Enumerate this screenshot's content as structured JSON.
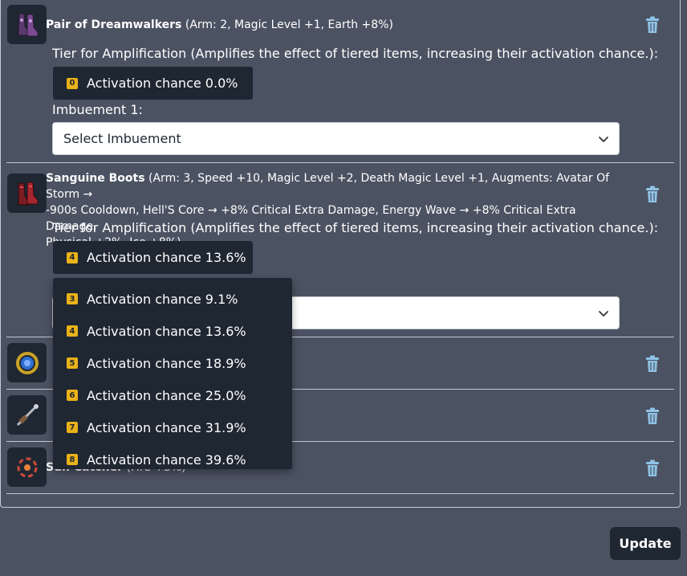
{
  "items": [
    {
      "name": "Pair of Dreamwalkers",
      "desc": "(Arm: 2, Magic Level +1, Earth +8%)",
      "icon": "dreamwalkers-boots-icon",
      "tier_label": "Tier for Amplification (Amplifies the effect of tiered items, increasing their activation chance.):",
      "tier_badge": "0",
      "tier_value": "Activation chance 0.0%",
      "imbuement_label": "Imbuement 1:",
      "imbuement_value": "Select Imbuement"
    },
    {
      "name": "Sanguine Boots",
      "desc_line1": "(Arm: 3, Speed +10, Magic Level +2, Death Magic Level +1, Augments: Avatar Of Storm →",
      "desc_line2": "-900s Cooldown, Hell'S Core → +8% Critical Extra Damage, Energy Wave → +8% Critical Extra Damage,",
      "desc_line3": "Physical +2%, Ice +8%)",
      "icon": "sanguine-boots-icon",
      "tier_label": "Tier for Amplification (Amplifies the effect of tiered items, increasing their activation chance.):",
      "tier_badge": "4",
      "tier_value": "Activation chance 13.6%"
    },
    {
      "icon": "ring-icon"
    },
    {
      "icon": "weapon-icon"
    },
    {
      "name": "Sun Catcher",
      "desc": "(Fire +5%)",
      "icon": "sun-catcher-icon"
    }
  ],
  "dropdown_options": [
    {
      "badge": "3",
      "label": "Activation chance 9.1%"
    },
    {
      "badge": "4",
      "label": "Activation chance 13.6%"
    },
    {
      "badge": "5",
      "label": "Activation chance 18.9%"
    },
    {
      "badge": "6",
      "label": "Activation chance 25.0%"
    },
    {
      "badge": "7",
      "label": "Activation chance 31.9%"
    },
    {
      "badge": "8",
      "label": "Activation chance 39.6%"
    }
  ],
  "update_label": "Update",
  "colors": {
    "background": "#4b5262",
    "panel_dark": "#1f2733",
    "badge": "#e9b218"
  }
}
